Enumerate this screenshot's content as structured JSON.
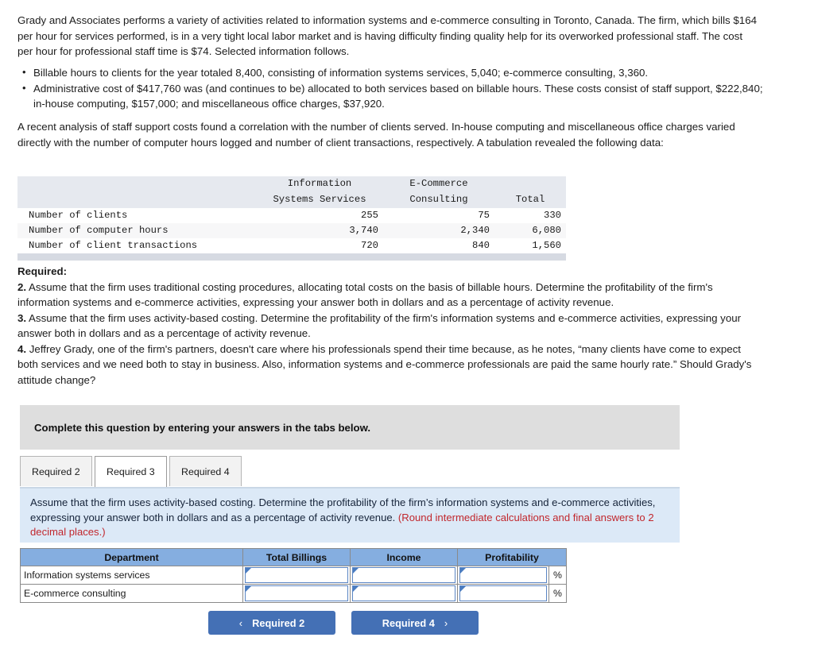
{
  "intro": {
    "paragraph": "Grady and Associates performs a variety of activities related to information systems and e-commerce consulting in Toronto, Canada. The firm, which bills $164 per hour for services performed, is in a very tight local labor market and is having difficulty finding quality help for its overworked professional staff. The cost per hour for professional staff time is $74. Selected information follows.",
    "bullets": [
      "Billable hours to clients for the year totaled 8,400, consisting of information systems services, 5,040; e-commerce consulting, 3,360.",
      "Administrative cost of $417,760 was (and continues to be) allocated to both services based on billable hours. These costs consist of staff support, $222,840; in-house computing, $157,000; and miscellaneous office charges, $37,920."
    ],
    "analysis": "A recent analysis of staff support costs found a correlation with the number of clients served. In-house computing and miscellaneous office charges varied directly with the number of computer hours logged and number of client transactions, respectively. A tabulation revealed the following data:"
  },
  "data_table": {
    "headers": {
      "blank": "",
      "col1_line1": "Information",
      "col1_line2": "Systems Services",
      "col2_line1": "E-Commerce",
      "col2_line2": "Consulting",
      "col3_line1": "",
      "col3_line2": "Total"
    },
    "rows": [
      {
        "label": "Number of clients",
        "systems": "255",
        "ecommerce": "75",
        "total": "330"
      },
      {
        "label": "Number of computer hours",
        "systems": "3,740",
        "ecommerce": "2,340",
        "total": "6,080"
      },
      {
        "label": "Number of client transactions",
        "systems": "720",
        "ecommerce": "840",
        "total": "1,560"
      }
    ]
  },
  "required": {
    "heading": "Required:",
    "item2_num": "2.",
    "item2_text": " Assume that the firm uses traditional costing procedures, allocating total costs on the basis of billable hours. Determine the profitability of the firm's information systems and e-commerce activities, expressing your answer both in dollars and as a percentage of activity revenue.",
    "item3_num": "3.",
    "item3_text": " Assume that the firm uses activity-based costing. Determine the profitability of the firm's information systems and e-commerce activities, expressing your answer both in dollars and as a percentage of activity revenue.",
    "item4_num": "4.",
    "item4_text": " Jeffrey Grady, one of the firm's partners, doesn't care where his professionals spend their time because, as he notes, “many clients have come to expect both services and we need both to stay in business. Also, information systems and e-commerce professionals are paid the same hourly rate.” Should Grady's attitude change?"
  },
  "banner": {
    "text": "Complete this question by entering your answers in the tabs below."
  },
  "tabs": [
    {
      "label": "Required 2",
      "active": false
    },
    {
      "label": "Required 3",
      "active": true
    },
    {
      "label": "Required 4",
      "active": false
    }
  ],
  "panel": {
    "main_text": "Assume that the firm uses activity-based costing. Determine the profitability of the firm’s information systems and e-commerce activities, expressing your answer both in dollars and as a percentage of activity revenue. ",
    "round_note": "(Round intermediate calculations and final answers to 2 decimal places.)",
    "note_color": "#c1272d"
  },
  "answer_table": {
    "headers": [
      "Department",
      "Total Billings",
      "Income",
      "Profitability"
    ],
    "rows": [
      {
        "department": "Information systems services",
        "total_billings": "",
        "income": "",
        "profitability": "",
        "pct_symbol": "%"
      },
      {
        "department": "E-commerce consulting",
        "total_billings": "",
        "income": "",
        "profitability": "",
        "pct_symbol": "%"
      }
    ],
    "header_color": "#85aee0"
  },
  "nav": {
    "prev_label": "Required 2",
    "prev_icon": "chevron-left-icon",
    "prev_chevron": "‹",
    "next_label": "Required 4",
    "next_icon": "chevron-right-icon",
    "next_chevron": "›",
    "button_color": "#4470b5"
  }
}
